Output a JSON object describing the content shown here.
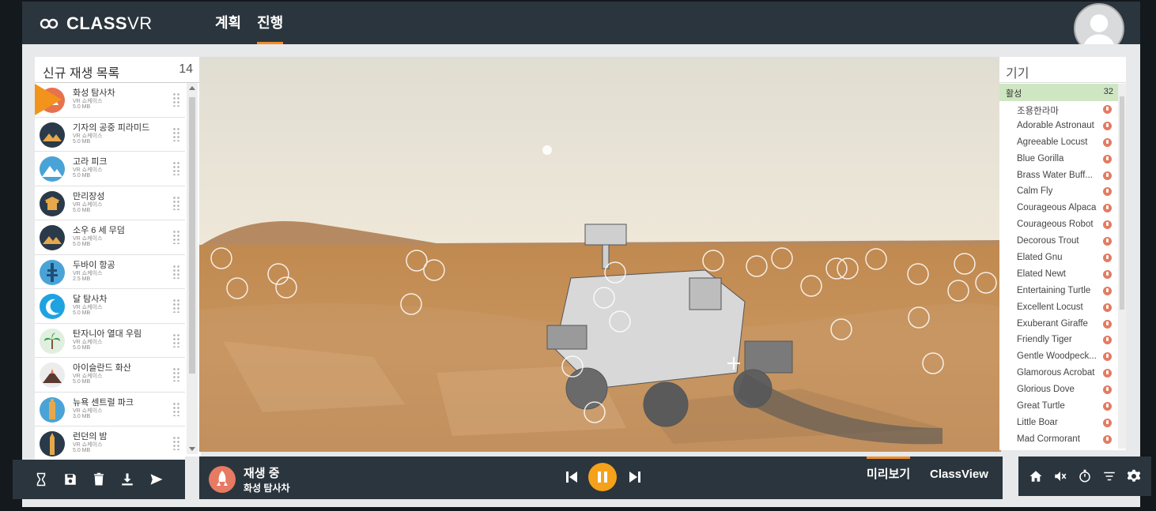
{
  "app": {
    "brand": "CLASSVR",
    "brand_bold": "CLASS",
    "brand_thin": "VR"
  },
  "nav": {
    "tabs": [
      {
        "label": "계획",
        "active": false
      },
      {
        "label": "진행",
        "active": true
      }
    ]
  },
  "playlist": {
    "title": "신규 재생 목록",
    "count": "14",
    "items": [
      {
        "title": "화성 탐사차",
        "type": "VR 쇼케이스",
        "size": "5.0 MB",
        "icon": "mars-rover-thumb"
      },
      {
        "title": "기자의 공중 피라미드",
        "type": "VR 쇼케이스",
        "size": "5.0 MB",
        "icon": "pyramid-thumb"
      },
      {
        "title": "고라 피크",
        "type": "VR 쇼케이스",
        "size": "5.0 MB",
        "icon": "mountain-thumb"
      },
      {
        "title": "만리장성",
        "type": "VR 쇼케이스",
        "size": "5.0 MB",
        "icon": "great-wall-thumb"
      },
      {
        "title": "소우 6 세 무덤",
        "type": "VR 쇼케이스",
        "size": "5.0 MB",
        "icon": "tomb-thumb"
      },
      {
        "title": "두바이 항공",
        "type": "VR 쇼케이스",
        "size": "2.5 MB",
        "icon": "dubai-thumb"
      },
      {
        "title": "달 탐사차",
        "type": "VR 쇼케이스",
        "size": "5.0 MB",
        "icon": "moon-thumb"
      },
      {
        "title": "탄자니아 열대 우림",
        "type": "VR 쇼케이스",
        "size": "5.0 MB",
        "icon": "palm-thumb"
      },
      {
        "title": "아이슬란드 화산",
        "type": "VR 쇼케이스",
        "size": "5.0 MB",
        "icon": "volcano-thumb"
      },
      {
        "title": "뉴욕 센트럴 파크",
        "type": "VR 쇼케이스",
        "size": "3.0 MB",
        "icon": "newyork-thumb"
      },
      {
        "title": "런던의 밤",
        "type": "VR 쇼케이스",
        "size": "5.0 MB",
        "icon": "london-thumb"
      }
    ]
  },
  "player": {
    "status": "재생 중",
    "current": "화성 탐사차",
    "preview_label": "미리보기",
    "classview_label": "ClassView"
  },
  "devices": {
    "title": "기기",
    "active_label": "활성",
    "active_count": "32",
    "items": [
      "조용한라마",
      "Adorable Astronaut",
      "Agreeable Locust",
      "Blue Gorilla",
      "Brass Water Buff...",
      "Calm Fly",
      "Courageous Alpaca",
      "Courageous Robot",
      "Decorous Trout",
      "Elated Gnu",
      "Elated Newt",
      "Entertaining Turtle",
      "Excellent Locust",
      "Exuberant Giraffe",
      "Friendly Tiger",
      "Gentle Woodpeck...",
      "Glamorous Acrobat",
      "Glorious Dove",
      "Great Turtle",
      "Little Boar",
      "Mad Cormorant"
    ]
  },
  "colors": {
    "accent": "#f28c28",
    "dark": "#2b353d",
    "device_status": "#e47b62",
    "active_bg": "#cfe6c3"
  }
}
